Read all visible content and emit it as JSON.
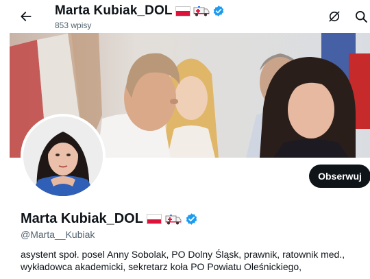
{
  "header": {
    "name": "Marta Kubiak_DOL",
    "post_count": "853 wpisy",
    "back_icon": "arrow-left-icon",
    "right_icons": [
      "ghost-icon",
      "search-icon"
    ]
  },
  "banner": {
    "description_icon": "banner-photo"
  },
  "profile": {
    "name": "Marta Kubiak_DOL",
    "handle": "@Marta__Kubiak",
    "follow_label": "Obserwuj",
    "bio_line1": "asystent społ. posel Anny Sobolak, PO Dolny Śląsk, prawnik, ratownik med.,",
    "bio_line2": "wykładowca akademicki, sekretarz koła PO Powiatu Oleśnickiego,"
  },
  "colors": {
    "verified": "#1d9bf0",
    "follow_bg": "#0f1419",
    "muted_text": "#536471",
    "flag_red": "#dc143c"
  }
}
